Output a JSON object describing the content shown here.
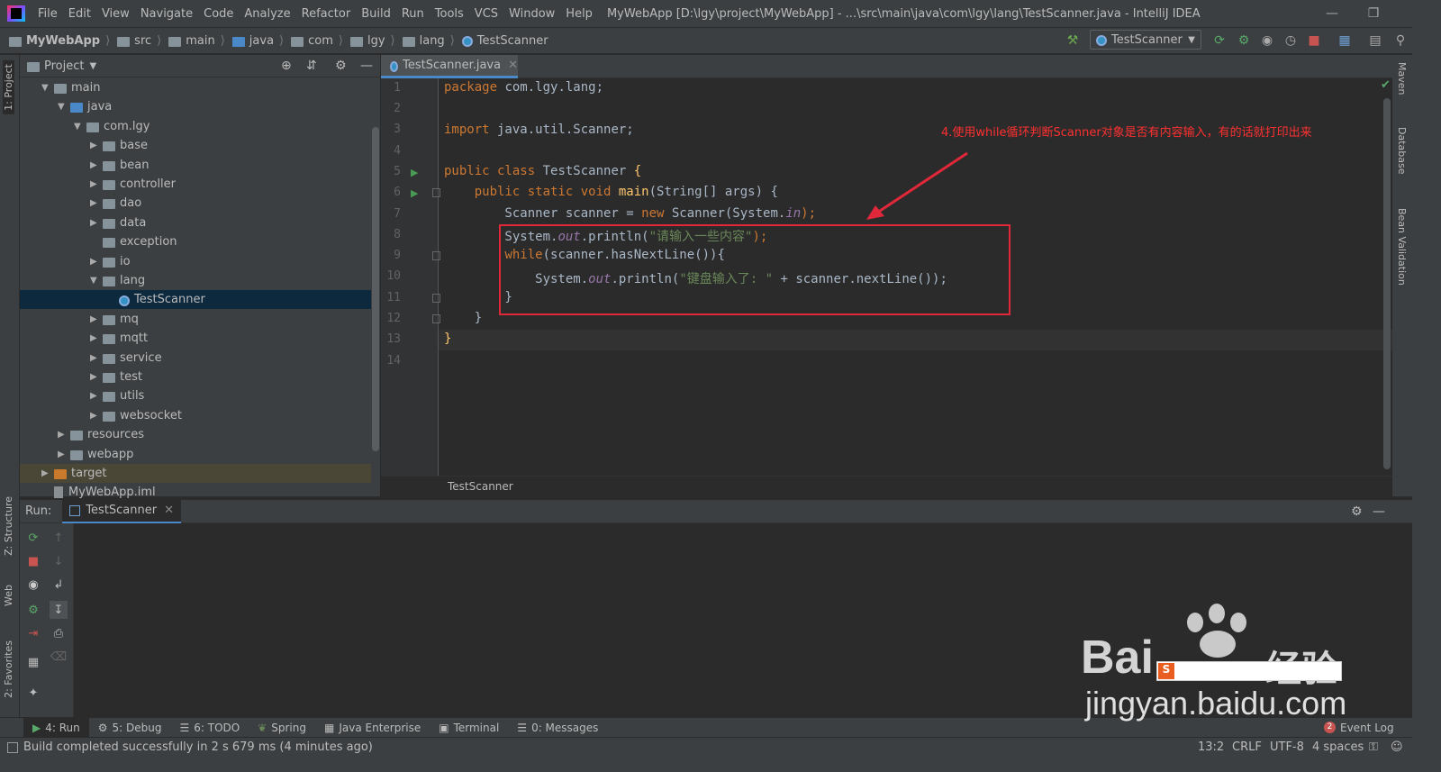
{
  "menu": [
    "File",
    "Edit",
    "View",
    "Navigate",
    "Code",
    "Analyze",
    "Refactor",
    "Build",
    "Run",
    "Tools",
    "VCS",
    "Window",
    "Help"
  ],
  "title": "MyWebApp [D:\\lgy\\project\\MyWebApp] - ...\\src\\main\\java\\com\\lgy\\lang\\TestScanner.java - IntelliJ IDEA",
  "title_project": "MyWebApp",
  "breadcrumbs": [
    "MyWebApp",
    "src",
    "main",
    "java",
    "com",
    "lgy",
    "lang",
    "TestScanner"
  ],
  "run_config": "TestScanner",
  "left_strip": {
    "project": "1: Project",
    "structure": "Z: Structure",
    "web": "Web",
    "favorites": "2: Favorites"
  },
  "right_strip": {
    "maven": "Maven",
    "database": "Database",
    "bean": "Bean Validation"
  },
  "project_panel": {
    "title": "Project",
    "tree": [
      {
        "label": "main",
        "indent": 1,
        "arrow": "down",
        "icon": "folder"
      },
      {
        "label": "java",
        "indent": 2,
        "arrow": "down",
        "icon": "folder-blue"
      },
      {
        "label": "com.lgy",
        "indent": 3,
        "arrow": "down",
        "icon": "folder"
      },
      {
        "label": "base",
        "indent": 4,
        "arrow": "right",
        "icon": "folder"
      },
      {
        "label": "bean",
        "indent": 4,
        "arrow": "right",
        "icon": "folder"
      },
      {
        "label": "controller",
        "indent": 4,
        "arrow": "right",
        "icon": "folder"
      },
      {
        "label": "dao",
        "indent": 4,
        "arrow": "right",
        "icon": "folder"
      },
      {
        "label": "data",
        "indent": 4,
        "arrow": "right",
        "icon": "folder"
      },
      {
        "label": "exception",
        "indent": 4,
        "arrow": "none",
        "icon": "folder"
      },
      {
        "label": "io",
        "indent": 4,
        "arrow": "right",
        "icon": "folder"
      },
      {
        "label": "lang",
        "indent": 4,
        "arrow": "down",
        "icon": "folder"
      },
      {
        "label": "TestScanner",
        "indent": 5,
        "arrow": "none",
        "icon": "class",
        "selected": true
      },
      {
        "label": "mq",
        "indent": 4,
        "arrow": "right",
        "icon": "folder"
      },
      {
        "label": "mqtt",
        "indent": 4,
        "arrow": "right",
        "icon": "folder"
      },
      {
        "label": "service",
        "indent": 4,
        "arrow": "right",
        "icon": "folder"
      },
      {
        "label": "test",
        "indent": 4,
        "arrow": "right",
        "icon": "folder"
      },
      {
        "label": "utils",
        "indent": 4,
        "arrow": "right",
        "icon": "folder"
      },
      {
        "label": "websocket",
        "indent": 4,
        "arrow": "right",
        "icon": "folder"
      },
      {
        "label": "resources",
        "indent": 2,
        "arrow": "right",
        "icon": "folder"
      },
      {
        "label": "webapp",
        "indent": 2,
        "arrow": "right",
        "icon": "folder"
      },
      {
        "label": "target",
        "indent": 1,
        "arrow": "right",
        "icon": "folder-orange",
        "highlight": true
      },
      {
        "label": "MyWebApp.iml",
        "indent": 1,
        "arrow": "none",
        "icon": "file"
      }
    ]
  },
  "editor": {
    "tab": "TestScanner.java",
    "line_numbers": [
      "1",
      "2",
      "3",
      "4",
      "5",
      "6",
      "7",
      "8",
      "9",
      "10",
      "11",
      "12",
      "13",
      "14"
    ],
    "annotation": "4.使用while循环判断Scanner对象是否有内容输入，有的话就打印出来",
    "footer": "TestScanner",
    "code": {
      "l1a": "package",
      "l1b": " com.lgy.lang;",
      "l3a": "import",
      "l3b": " java.util.Scanner;",
      "l5a": "public class",
      "l5b": " TestScanner ",
      "l5c": "{",
      "l6a": "    public static void ",
      "l6b": "main",
      "l6c": "(String[] args) {",
      "l7a": "        Scanner scanner = ",
      "l7b": "new",
      "l7c": " Scanner(System.",
      "l7d": "in",
      "l7e": ");",
      "l8a": "        System.",
      "l8b": "out",
      "l8c": ".println(",
      "l8d": "\"请输入一些内容\"",
      "l8e": ");",
      "l9a": "        ",
      "l9b": "while",
      "l9c": "(scanner.hasNextLine()){",
      "l10a": "            System.",
      "l10b": "out",
      "l10c": ".println(",
      "l10d": "\"键盘输入了: \"",
      "l10e": " + scanner.nextLine());",
      "l11": "        }",
      "l12": "    }",
      "l13": "}"
    }
  },
  "run_panel": {
    "label": "Run:",
    "tab": "TestScanner"
  },
  "bottom_tabs": [
    "4: Run",
    "5: Debug",
    "6: TODO",
    "Spring",
    "Java Enterprise",
    "Terminal",
    "0: Messages"
  ],
  "event_log": {
    "count": "2",
    "label": "Event Log"
  },
  "status": {
    "message": "Build completed successfully in 2 s 679 ms (4 minutes ago)",
    "position": "13:2",
    "line_sep": "CRLF",
    "encoding": "UTF-8",
    "indent": "4 spaces"
  },
  "watermark": {
    "brand": "Bai",
    "brand2": "经验",
    "url": "jingyan.baidu.com"
  },
  "colors": {
    "bg": "#2b2b2b",
    "panel": "#3c3f41",
    "keyword": "#cc7832",
    "string": "#6a8759",
    "method": "#ffc66d",
    "field": "#9876aa",
    "annotation": "#ff3030",
    "box": "#e0283a",
    "selection": "#0d293e"
  }
}
